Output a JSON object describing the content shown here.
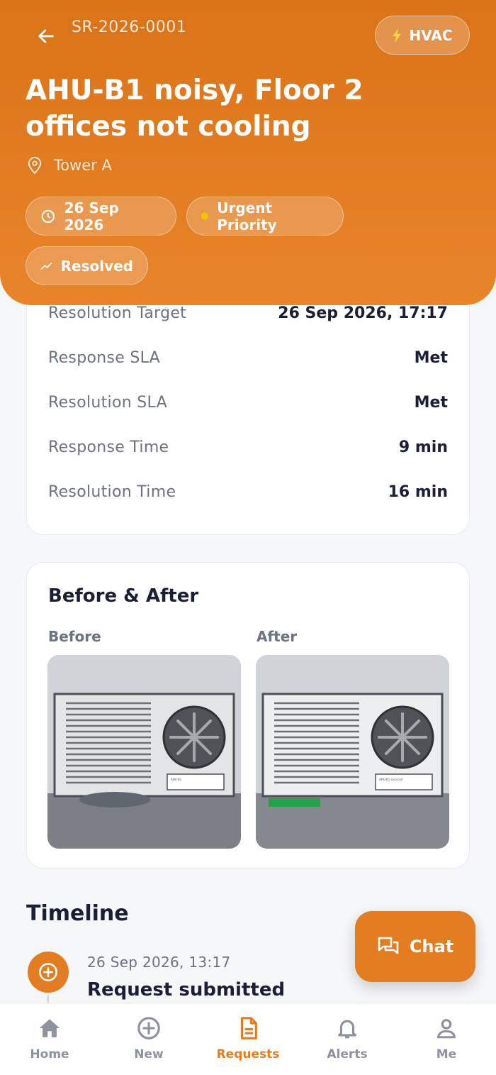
{
  "header": {
    "request_id": "SR-2026-0001",
    "category": "HVAC",
    "title": "AHU-B1 noisy, Floor 2 offices not cooling",
    "location": "Tower A",
    "date": "26 Sep 2026",
    "priority": "Urgent Priority",
    "status": "Resolved",
    "colors": {
      "accent": "#e47d22",
      "priority_dot": "#f4c20d"
    }
  },
  "sla": {
    "rows": [
      {
        "label": "Resolution Target",
        "value": "26 Sep 2026, 17:17"
      },
      {
        "label": "Response SLA",
        "value": "Met"
      },
      {
        "label": "Resolution SLA",
        "value": "Met"
      },
      {
        "label": "Response Time",
        "value": "9 min"
      },
      {
        "label": "Resolution Time",
        "value": "16 min"
      }
    ]
  },
  "before_after": {
    "title": "Before & After",
    "before_label": "Before",
    "after_label": "After",
    "before_tag": "AHU-B1",
    "after_tag": "AHU-B1 serviced"
  },
  "timeline": {
    "title": "Timeline",
    "events": [
      {
        "time": "26 Sep 2026, 13:17",
        "title": "Request submitted",
        "icon": "plus-circle-icon"
      }
    ]
  },
  "chat": {
    "label": "Chat"
  },
  "nav": {
    "items": [
      {
        "label": "Home",
        "icon": "home-icon"
      },
      {
        "label": "New",
        "icon": "plus-circle-icon"
      },
      {
        "label": "Requests",
        "icon": "document-icon",
        "active": true
      },
      {
        "label": "Alerts",
        "icon": "bell-icon"
      },
      {
        "label": "Me",
        "icon": "person-icon"
      }
    ]
  }
}
